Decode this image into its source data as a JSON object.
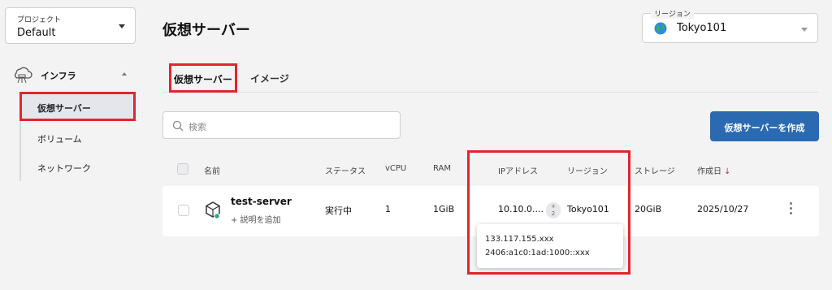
{
  "sidebar": {
    "project_label": "プロジェクト",
    "project_value": "Default",
    "section_label": "インフラ",
    "items": [
      {
        "label": "仮想サーバー",
        "active": true
      },
      {
        "label": "ボリューム",
        "active": false
      },
      {
        "label": "ネットワーク",
        "active": false
      }
    ]
  },
  "header": {
    "title": "仮想サーバー",
    "region_label": "リージョン",
    "region_value": "Tokyo101"
  },
  "tabs": [
    {
      "label": "仮想サーバー",
      "active": true
    },
    {
      "label": "イメージ",
      "active": false
    }
  ],
  "search": {
    "placeholder": "検索"
  },
  "create_button": "仮想サーバーを作成",
  "table": {
    "headers": {
      "name": "名前",
      "status": "ステータス",
      "vcpu": "vCPU",
      "ram": "RAM",
      "ip": "IPアドレス",
      "region": "リージョン",
      "storage": "ストレージ",
      "created": "作成日",
      "sort_indicator": "↓"
    },
    "rows": [
      {
        "name": "test-server",
        "add_description": "+ 説明を追加",
        "status": "実行中",
        "vcpu": "1",
        "ram": "1GiB",
        "ip": "10.10.0....",
        "ip_extra_count": "+\n2",
        "region": "Tokyo101",
        "storage": "20GiB",
        "created": "2025/10/27"
      }
    ]
  },
  "ip_tooltip": {
    "line1": "133.117.155.xxx",
    "line2": "2406:a1c0:1ad:1000::xxx"
  },
  "colors": {
    "primary": "#2b6ab0",
    "highlight": "#e2252d",
    "status_dot": "#2aa88a"
  }
}
